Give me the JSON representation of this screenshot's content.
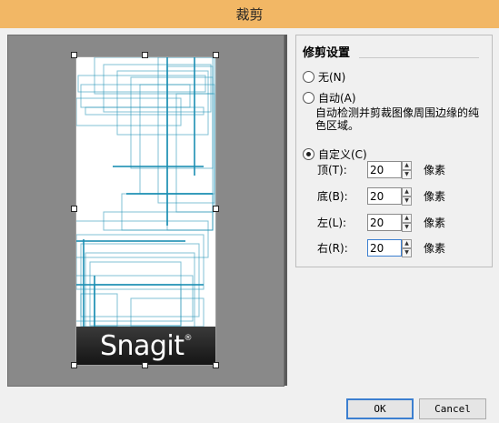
{
  "window": {
    "title": "裁剪"
  },
  "preview": {
    "logo_text": "Snagit"
  },
  "settings": {
    "group_title": "修剪设置",
    "options": [
      {
        "label": "无(N)",
        "checked": false
      },
      {
        "label": "自动(A)",
        "checked": false
      },
      {
        "label": "自定义(C)",
        "checked": true
      }
    ],
    "auto_description": "自动检测并剪裁图像周围边缘的纯色区域。",
    "fields": [
      {
        "label": "顶(T):",
        "value": "20",
        "unit": "像素"
      },
      {
        "label": "底(B):",
        "value": "20",
        "unit": "像素"
      },
      {
        "label": "左(L):",
        "value": "20",
        "unit": "像素"
      },
      {
        "label": "右(R):",
        "value": "20",
        "unit": "像素"
      }
    ]
  },
  "buttons": {
    "ok": "OK",
    "cancel": "Cancel"
  },
  "colors": {
    "titlebar": "#f2b765",
    "preview_bg": "#898989",
    "line_color": "#1b8fb3"
  }
}
